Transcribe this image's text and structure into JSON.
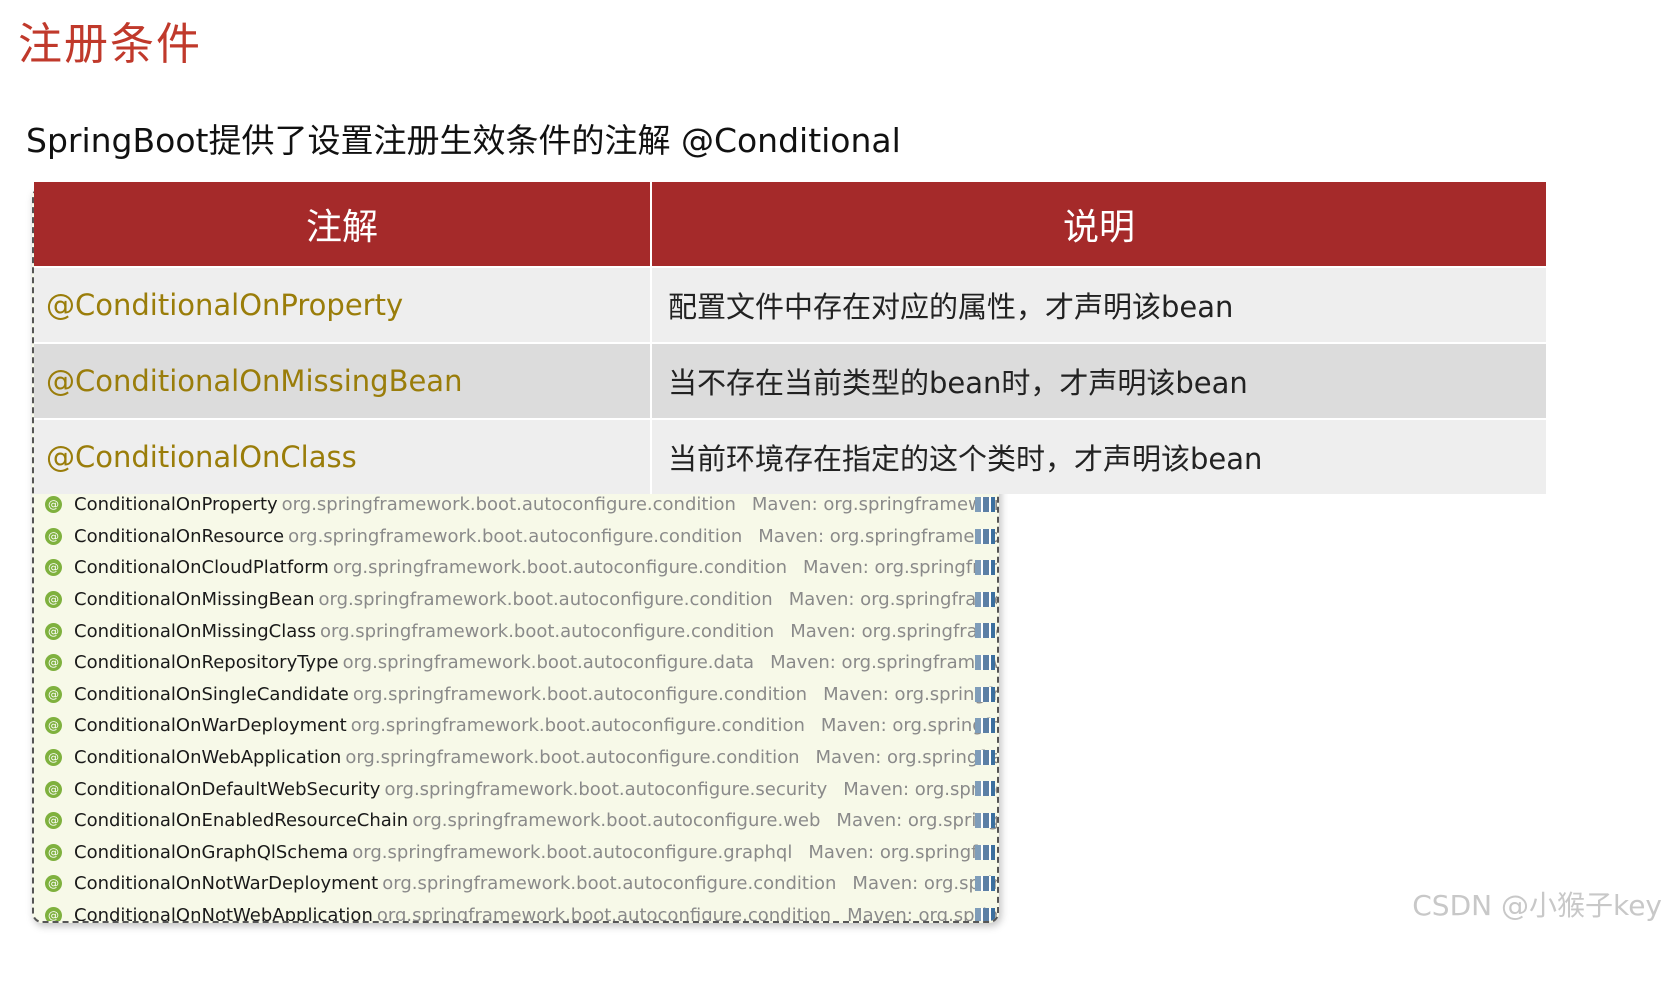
{
  "title": "注册条件",
  "subtitle": "SpringBoot提供了设置注册生效条件的注解 @Conditional",
  "table": {
    "headers": [
      "注解",
      "说明"
    ],
    "rows": [
      {
        "annotation": "@ConditionalOnProperty",
        "description": "配置文件中存在对应的属性，才声明该bean"
      },
      {
        "annotation": "@ConditionalOnMissingBean",
        "description": "当不存在当前类型的bean时，才声明该bean"
      },
      {
        "annotation": "@ConditionalOnClass",
        "description": "当前环境存在指定的这个类时，才声明该bean"
      }
    ]
  },
  "popup": {
    "items": [
      {
        "name": "ConditionalOnProperty",
        "pkg": "org.springframework.boot.autoconfigure.condition",
        "maven": "Maven: org.springframewor..."
      },
      {
        "name": "ConditionalOnResource",
        "pkg": "org.springframework.boot.autoconfigure.condition",
        "maven": "Maven: org.springframewor..."
      },
      {
        "name": "ConditionalOnCloudPlatform",
        "pkg": "org.springframework.boot.autoconfigure.condition",
        "maven": "Maven: org.springfram..."
      },
      {
        "name": "ConditionalOnMissingBean",
        "pkg": "org.springframework.boot.autoconfigure.condition",
        "maven": "Maven: org.springframe..."
      },
      {
        "name": "ConditionalOnMissingClass",
        "pkg": "org.springframework.boot.autoconfigure.condition",
        "maven": "Maven: org.springframe..."
      },
      {
        "name": "ConditionalOnRepositoryType",
        "pkg": "org.springframework.boot.autoconfigure.data",
        "maven": "Maven: org.springframew..."
      },
      {
        "name": "ConditionalOnSingleCandidate",
        "pkg": "org.springframework.boot.autoconfigure.condition",
        "maven": "Maven: org.springfra..."
      },
      {
        "name": "ConditionalOnWarDeployment",
        "pkg": "org.springframework.boot.autoconfigure.condition",
        "maven": "Maven: org.springfra..."
      },
      {
        "name": "ConditionalOnWebApplication",
        "pkg": "org.springframework.boot.autoconfigure.condition",
        "maven": "Maven: org.springfra..."
      },
      {
        "name": "ConditionalOnDefaultWebSecurity",
        "pkg": "org.springframework.boot.autoconfigure.security",
        "maven": "Maven: org.springf..."
      },
      {
        "name": "ConditionalOnEnabledResourceChain",
        "pkg": "org.springframework.boot.autoconfigure.web",
        "maven": "Maven: org.springfr..."
      },
      {
        "name": "ConditionalOnGraphQlSchema",
        "pkg": "org.springframework.boot.autoconfigure.graphql",
        "maven": "Maven: org.springfram..."
      },
      {
        "name": "ConditionalOnNotWarDeployment",
        "pkg": "org.springframework.boot.autoconfigure.condition",
        "maven": "Maven: org.sprin..."
      },
      {
        "name": "ConditionalOnNotWebApplication",
        "pkg": "org.springframework.boot.autoconfigure.condition",
        "maven": "Maven: org.sprin..."
      }
    ],
    "icon_glyph": "@"
  },
  "watermark": "CSDN @小猴子key",
  "colors": {
    "title": "#c0392b",
    "header_bg": "#a52a2a",
    "annotation_text": "#9a7d0a",
    "popup_bg": "#f7f9e8",
    "annotation_icon": "#7fb13e"
  }
}
